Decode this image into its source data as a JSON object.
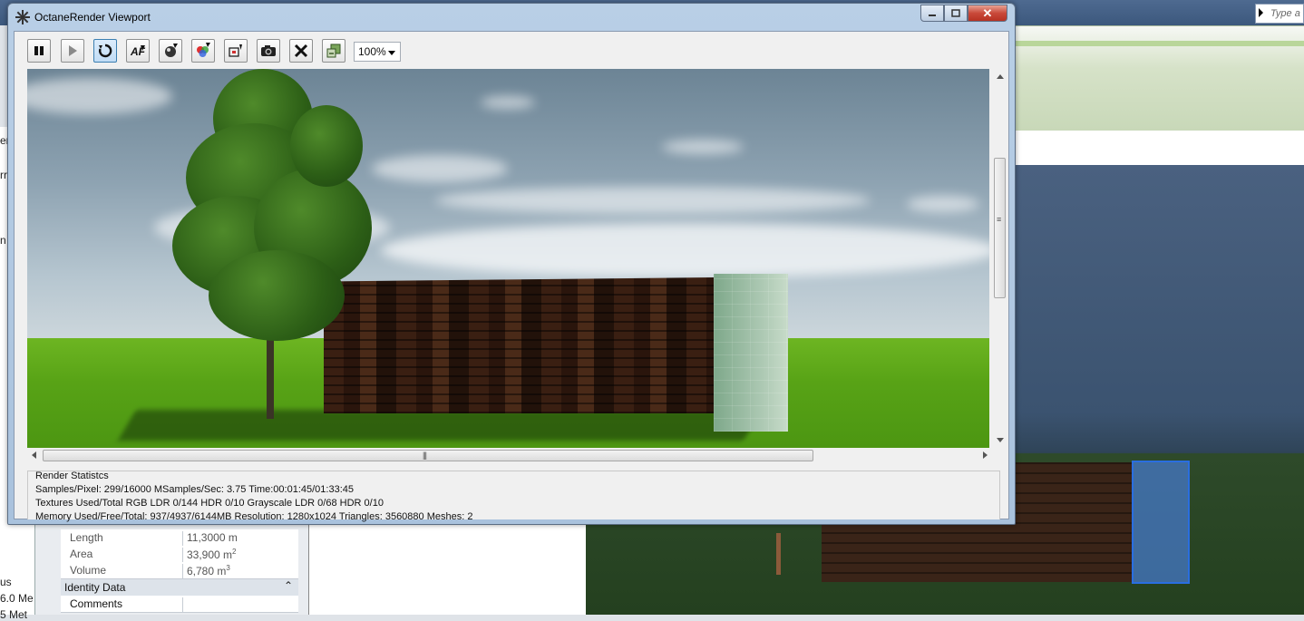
{
  "window": {
    "title": "OctaneRender Viewport",
    "close_glyph": "✕"
  },
  "toolbar": {
    "buttons": [
      {
        "name": "pause-icon"
      },
      {
        "name": "play-icon"
      },
      {
        "name": "restart-icon"
      },
      {
        "name": "focus-picker-icon"
      },
      {
        "name": "material-picker-icon"
      },
      {
        "name": "color-picker-icon"
      },
      {
        "name": "export-icon"
      },
      {
        "name": "camera-icon"
      },
      {
        "name": "stop-icon"
      },
      {
        "name": "save-image-icon"
      }
    ],
    "zoom": "100%"
  },
  "stats": {
    "title": "Render Statistcs",
    "line1": "Samples/Pixel: 299/16000  MSamples/Sec: 3.75  Time:00:01:45/01:33:45",
    "line2": "Textures Used/Total RGB LDR 0/144  HDR 0/10  Grayscale LDR 0/68  HDR 0/10",
    "line3": "Memory Used/Free/Total: 937/4937/6144MB  Resolution: 1280x1024  Triangles: 3560880  Meshes:  2"
  },
  "background": {
    "search_placeholder": "Type a",
    "left_fragments": [
      "er",
      "rr",
      "n",
      "us",
      "6.0 Me",
      "5 Met"
    ],
    "properties": [
      {
        "label": "Length",
        "value": "11,3000 m"
      },
      {
        "label": "Area",
        "value": "33,900 m",
        "unit_sup": "2"
      },
      {
        "label": "Volume",
        "value": "6,780 m",
        "unit_sup": "3"
      }
    ],
    "group": "Identity Data",
    "group_chevron": "⌃",
    "comments": "Comments"
  },
  "colors": {
    "title_bar": "#b9cfe6",
    "close_button": "#c9493a",
    "grass": "#58a316",
    "selection": "#2a6ee0"
  }
}
